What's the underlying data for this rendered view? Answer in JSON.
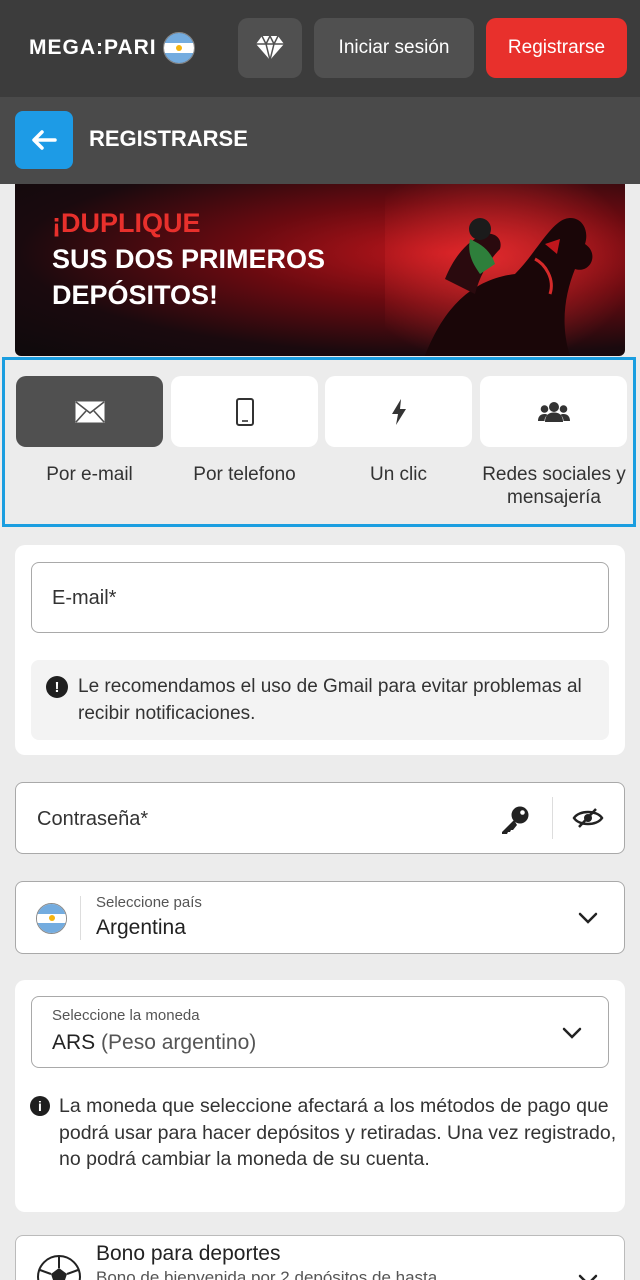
{
  "header": {
    "logo_text": "MEGA:PARI",
    "login_label": "Iniciar sesión",
    "register_label": "Registrarse"
  },
  "subheader": {
    "title": "REGISTRARSE"
  },
  "banner": {
    "line1": "¡DUPLIQUE",
    "line2": "SUS DOS PRIMEROS",
    "line3": "DEPÓSITOS!"
  },
  "tabs": [
    {
      "label": "Por e-mail",
      "icon": "envelope-icon",
      "active": true
    },
    {
      "label": "Por telefono",
      "icon": "phone-icon",
      "active": false
    },
    {
      "label": "Un clic",
      "icon": "lightning-icon",
      "active": false
    },
    {
      "label": "Redes sociales y mensajería",
      "icon": "users-icon",
      "active": false
    }
  ],
  "email": {
    "placeholder": "E-mail*",
    "hint": "Le recomendamos el uso de Gmail para evitar problemas al recibir notificaciones."
  },
  "password": {
    "placeholder": "Contraseña*"
  },
  "country": {
    "label": "Seleccione país",
    "value": "Argentina"
  },
  "currency": {
    "label": "Seleccione la moneda",
    "code": "ARS",
    "name": "(Peso argentino)",
    "hint": "La moneda que seleccione afectará a los métodos de pago que podrá usar para hacer depósitos y retiradas. Una vez registrado, no podrá cambiar la moneda de su cuenta."
  },
  "bonus": {
    "title": "Bono para deportes",
    "description": "Bono de bienvenida por 2 depósitos de hasta"
  },
  "colors": {
    "accent": "#1d9be6",
    "primary_red": "#e8302c",
    "header_bg": "#3c3c3c"
  }
}
